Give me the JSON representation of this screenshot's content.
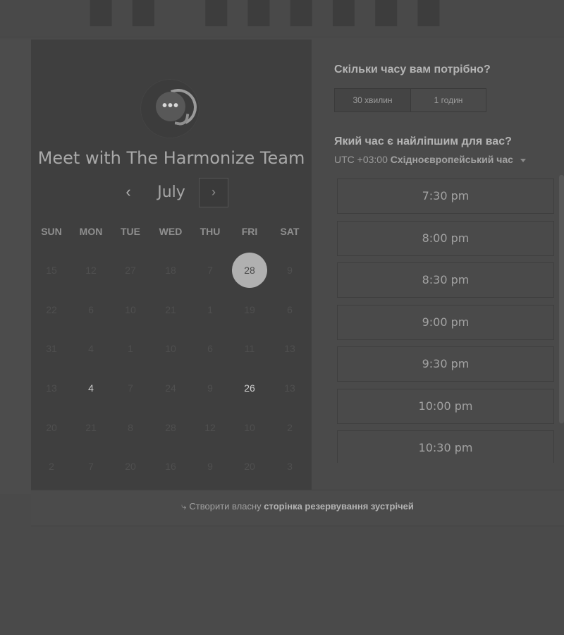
{
  "header": {
    "brand_text": ""
  },
  "calendar": {
    "title": "Meet with The Harmonize Team",
    "month": "July",
    "prev_icon": "chevron-left-icon",
    "next_icon": "chevron-right-icon",
    "weekdays": [
      "SUN",
      "MON",
      "TUE",
      "WED",
      "THU",
      "FRI",
      "SAT"
    ],
    "weeks": [
      [
        "15",
        "12",
        "27",
        "18",
        "7",
        "28",
        "9"
      ],
      [
        "22",
        "6",
        "10",
        "21",
        "1",
        "19",
        "6"
      ],
      [
        "31",
        "4",
        "1",
        "10",
        "6",
        "11",
        "13"
      ],
      [
        "13",
        "4",
        "7",
        "24",
        "9",
        "26",
        "13"
      ],
      [
        "20",
        "21",
        "8",
        "28",
        "12",
        "10",
        "2"
      ],
      [
        "2",
        "7",
        "20",
        "16",
        "9",
        "20",
        "3"
      ]
    ],
    "selected_day": "28",
    "available_days": [
      "4",
      "26"
    ]
  },
  "duration": {
    "question": "Скільки часу вам потрібно?",
    "options": [
      "30 хвилин",
      "1 годин"
    ],
    "active_index": 0
  },
  "time": {
    "question": "Який час є найліпшим для вас?",
    "tz_offset": "UTC +03:00",
    "tz_name": "Східноєвропейський час",
    "slots": [
      "7:30 pm",
      "8:00 pm",
      "8:30 pm",
      "9:00 pm",
      "9:30 pm",
      "10:00 pm",
      "10:30 pm"
    ]
  },
  "footer": {
    "prefix": "Створити власну",
    "link": "сторінка резервування зустрічей"
  },
  "colors": {
    "background": "#4a4a4a",
    "card": "#3f3f3f",
    "selected_day": "#b0b0b0"
  }
}
